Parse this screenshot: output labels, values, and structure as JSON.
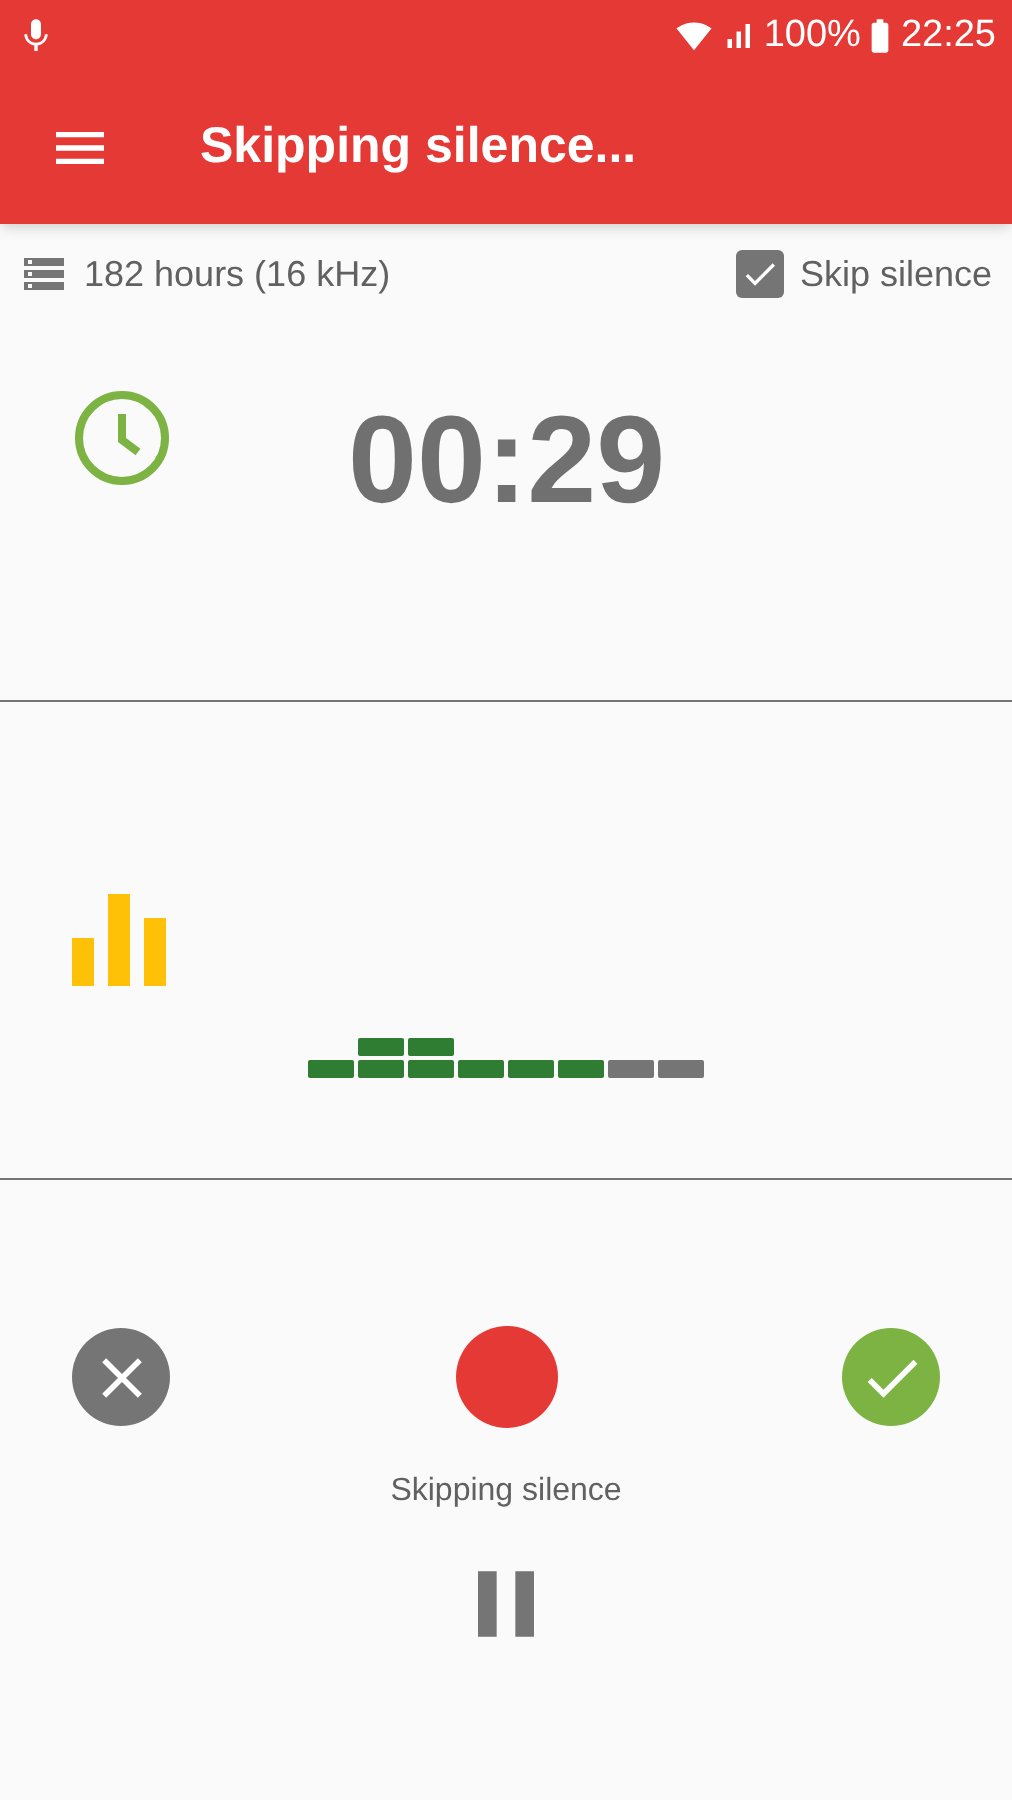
{
  "status_bar": {
    "battery": "100%",
    "time": "22:25"
  },
  "toolbar": {
    "title": "Skipping silence..."
  },
  "info": {
    "storage": "182 hours (16 kHz)",
    "skip_silence": {
      "label": "Skip silence",
      "checked": true
    }
  },
  "timer": {
    "elapsed": "00:29"
  },
  "meter": {
    "level": 0.75
  },
  "controls": {
    "status": "Skipping silence"
  }
}
